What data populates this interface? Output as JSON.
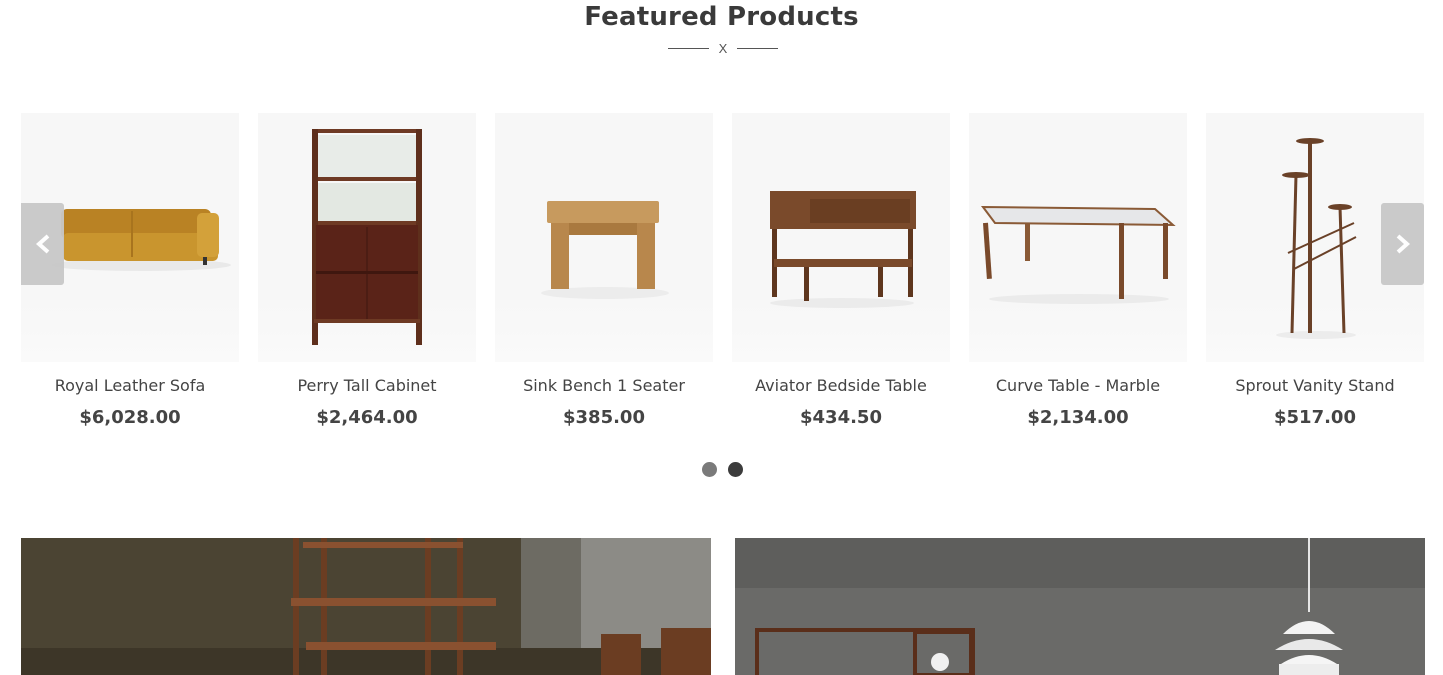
{
  "section": {
    "title": "Featured Products",
    "divider_mark": "X"
  },
  "carousel": {
    "prev_icon": "chevron-left-icon",
    "next_icon": "chevron-right-icon",
    "products": [
      {
        "name": "Royal Leather Sofa",
        "price": "$6,028.00",
        "image": "sofa"
      },
      {
        "name": "Perry Tall Cabinet",
        "price": "$2,464.00",
        "image": "cabinet"
      },
      {
        "name": "Sink Bench 1 Seater",
        "price": "$385.00",
        "image": "bench"
      },
      {
        "name": "Aviator Bedside Table",
        "price": "$434.50",
        "image": "bedside-table"
      },
      {
        "name": "Curve Table - Marble",
        "price": "$2,134.00",
        "image": "marble-table"
      },
      {
        "name": "Sprout Vanity Stand",
        "price": "$517.00",
        "image": "vanity-stand"
      }
    ],
    "pagination": {
      "pages": 2,
      "active": 1
    }
  },
  "banners": [
    {
      "image": "wooden-shelf-scene"
    },
    {
      "image": "pendant-lamp-scene"
    }
  ],
  "colors": {
    "text": "#444444",
    "arrow_bg": "#c8c8c8",
    "dot_inactive": "#3c3c3c",
    "dot_active": "#7a7a7a",
    "wood": "#7a4a2b",
    "leather": "#c9952e"
  }
}
